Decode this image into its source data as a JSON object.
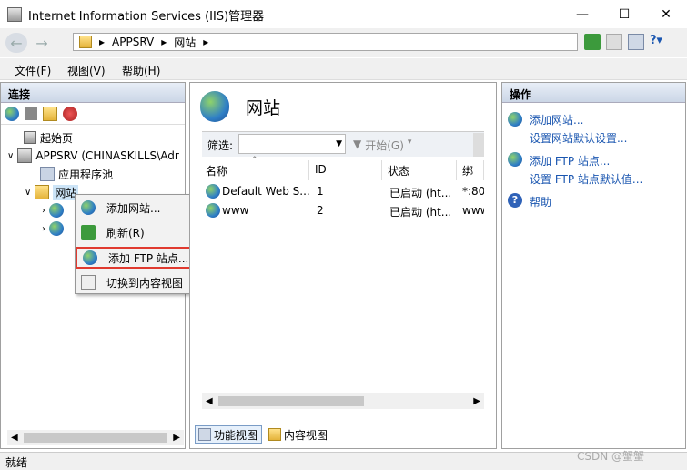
{
  "window": {
    "title": "Internet Information Services (IIS)管理器"
  },
  "address": {
    "segments": [
      "APPSRV",
      "网站"
    ]
  },
  "menu": {
    "items": [
      "文件(F)",
      "视图(V)",
      "帮助(H)"
    ]
  },
  "connections": {
    "header": "连接",
    "tree": {
      "start": "起始页",
      "server": "APPSRV (CHINASKILLS\\Adr",
      "apppools": "应用程序池",
      "sites": "网站"
    }
  },
  "context_menu": {
    "items": [
      "添加网站...",
      "刷新(R)",
      "添加 FTP 站点...",
      "切换到内容视图"
    ]
  },
  "center": {
    "title": "网站",
    "filter_label": "筛选:",
    "go_label": "开始(G)",
    "columns": [
      "名称",
      "ID",
      "状态",
      "绑定"
    ],
    "rows": [
      [
        "Default Web S...",
        "1",
        "已启动 (ht...",
        "*:80"
      ],
      [
        "www",
        "2",
        "已启动 (ht...",
        "www"
      ]
    ],
    "features_view": "功能视图",
    "content_view": "内容视图"
  },
  "actions": {
    "header": "操作",
    "items": [
      "添加网站...",
      "设置网站默认设置...",
      "添加 FTP 站点...",
      "设置 FTP 站点默认值...",
      "帮助"
    ]
  },
  "status": {
    "text": "就绪",
    "watermark": "CSDN @蟹蟹"
  }
}
